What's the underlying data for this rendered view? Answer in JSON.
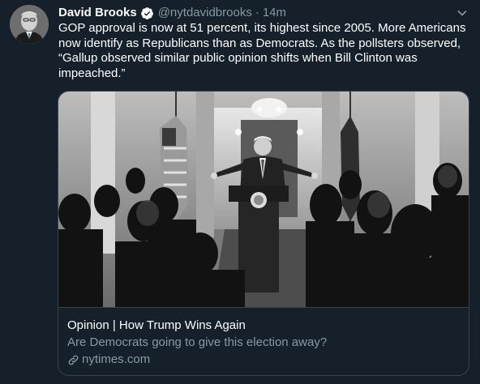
{
  "tweet": {
    "author_name": "David Brooks",
    "handle": "@nytdavidbrooks",
    "separator": "·",
    "time": "14m",
    "text": "GOP approval  is now at 51 percent, its highest since 2005. More Americans now identify as Republicans than as Democrats. As the pollsters observed, “Gallup observed similar public opinion shifts when Bill Clinton was impeached.”"
  },
  "card": {
    "title": "Opinion | How Trump Wins Again",
    "description": "Are Democrats going to give this election away?",
    "domain": "nytimes.com"
  },
  "icons": {
    "verified": "verified-badge-icon",
    "caret": "chevron-down-icon",
    "link": "link-icon"
  },
  "colors": {
    "background": "#15202b",
    "secondary_text": "#8899a6",
    "border": "#38444d",
    "verified_blue": "#ffffff"
  }
}
